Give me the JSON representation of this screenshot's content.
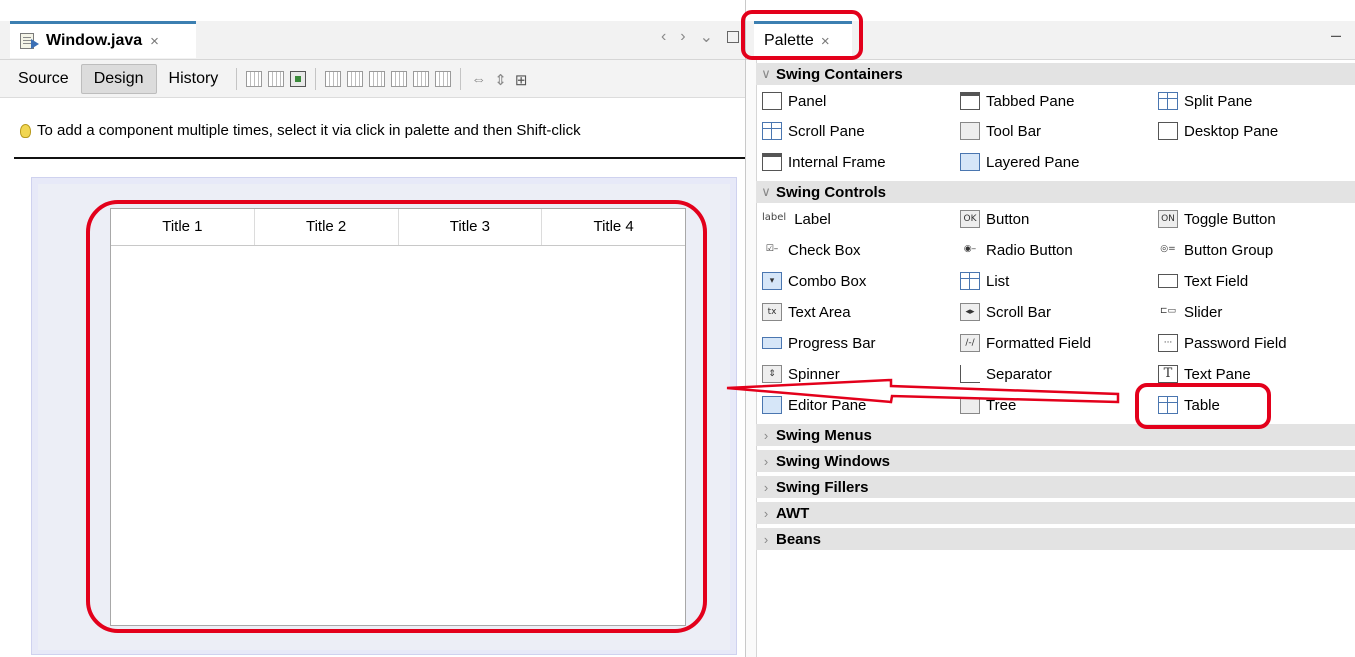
{
  "editor": {
    "tab_title": "Window.java",
    "tab_close": "×",
    "nav": {
      "back": "‹",
      "forward": "›",
      "menu": "⌄"
    },
    "modes": [
      "Source",
      "Design",
      "History"
    ],
    "selected_mode": "Design",
    "hint": "To add a component multiple times, select it via click in palette and then Shift-click",
    "table_headers": [
      "Title 1",
      "Title 2",
      "Title 3",
      "Title 4"
    ]
  },
  "palette": {
    "tab_title": "Palette",
    "tab_close": "×",
    "minimize": "–",
    "categories": [
      {
        "name": "Swing Containers",
        "expanded": true,
        "items": [
          {
            "label": "Panel",
            "icon": "panel-icon"
          },
          {
            "label": "Tabbed Pane",
            "icon": "tabbed-pane-icon"
          },
          {
            "label": "Split Pane",
            "icon": "split-pane-icon"
          },
          {
            "label": "Scroll Pane",
            "icon": "scroll-pane-icon"
          },
          {
            "label": "Tool Bar",
            "icon": "tool-bar-icon"
          },
          {
            "label": "Desktop Pane",
            "icon": "desktop-pane-icon"
          },
          {
            "label": "Internal Frame",
            "icon": "internal-frame-icon"
          },
          {
            "label": "Layered Pane",
            "icon": "layered-pane-icon"
          }
        ]
      },
      {
        "name": "Swing Controls",
        "expanded": true,
        "items": [
          {
            "label": "Label",
            "icon": "label-icon",
            "icon_text": "label"
          },
          {
            "label": "Button",
            "icon": "button-icon",
            "icon_text": "OK"
          },
          {
            "label": "Toggle Button",
            "icon": "toggle-button-icon",
            "icon_text": "ON"
          },
          {
            "label": "Check Box",
            "icon": "check-box-icon"
          },
          {
            "label": "Radio Button",
            "icon": "radio-button-icon"
          },
          {
            "label": "Button Group",
            "icon": "button-group-icon"
          },
          {
            "label": "Combo Box",
            "icon": "combo-box-icon"
          },
          {
            "label": "List",
            "icon": "list-icon"
          },
          {
            "label": "Text Field",
            "icon": "text-field-icon"
          },
          {
            "label": "Text Area",
            "icon": "text-area-icon",
            "icon_text": "tx"
          },
          {
            "label": "Scroll Bar",
            "icon": "scroll-bar-icon"
          },
          {
            "label": "Slider",
            "icon": "slider-icon"
          },
          {
            "label": "Progress Bar",
            "icon": "progress-bar-icon"
          },
          {
            "label": "Formatted Field",
            "icon": "formatted-field-icon"
          },
          {
            "label": "Password Field",
            "icon": "password-field-icon",
            "icon_text": "···"
          },
          {
            "label": "Spinner",
            "icon": "spinner-icon"
          },
          {
            "label": "Separator",
            "icon": "separator-icon"
          },
          {
            "label": "Text Pane",
            "icon": "text-pane-icon",
            "icon_text": "T"
          },
          {
            "label": "Editor Pane",
            "icon": "editor-pane-icon"
          },
          {
            "label": "Tree",
            "icon": "tree-icon"
          },
          {
            "label": "Table",
            "icon": "table-icon"
          }
        ]
      },
      {
        "name": "Swing Menus",
        "expanded": false
      },
      {
        "name": "Swing Windows",
        "expanded": false
      },
      {
        "name": "Swing Fillers",
        "expanded": false
      },
      {
        "name": "AWT",
        "expanded": false
      },
      {
        "name": "Beans",
        "expanded": false
      }
    ]
  },
  "colors": {
    "annotation": "#e3001b",
    "tab_accent": "#3c7fb1",
    "category_bg": "#e3e3e3"
  }
}
